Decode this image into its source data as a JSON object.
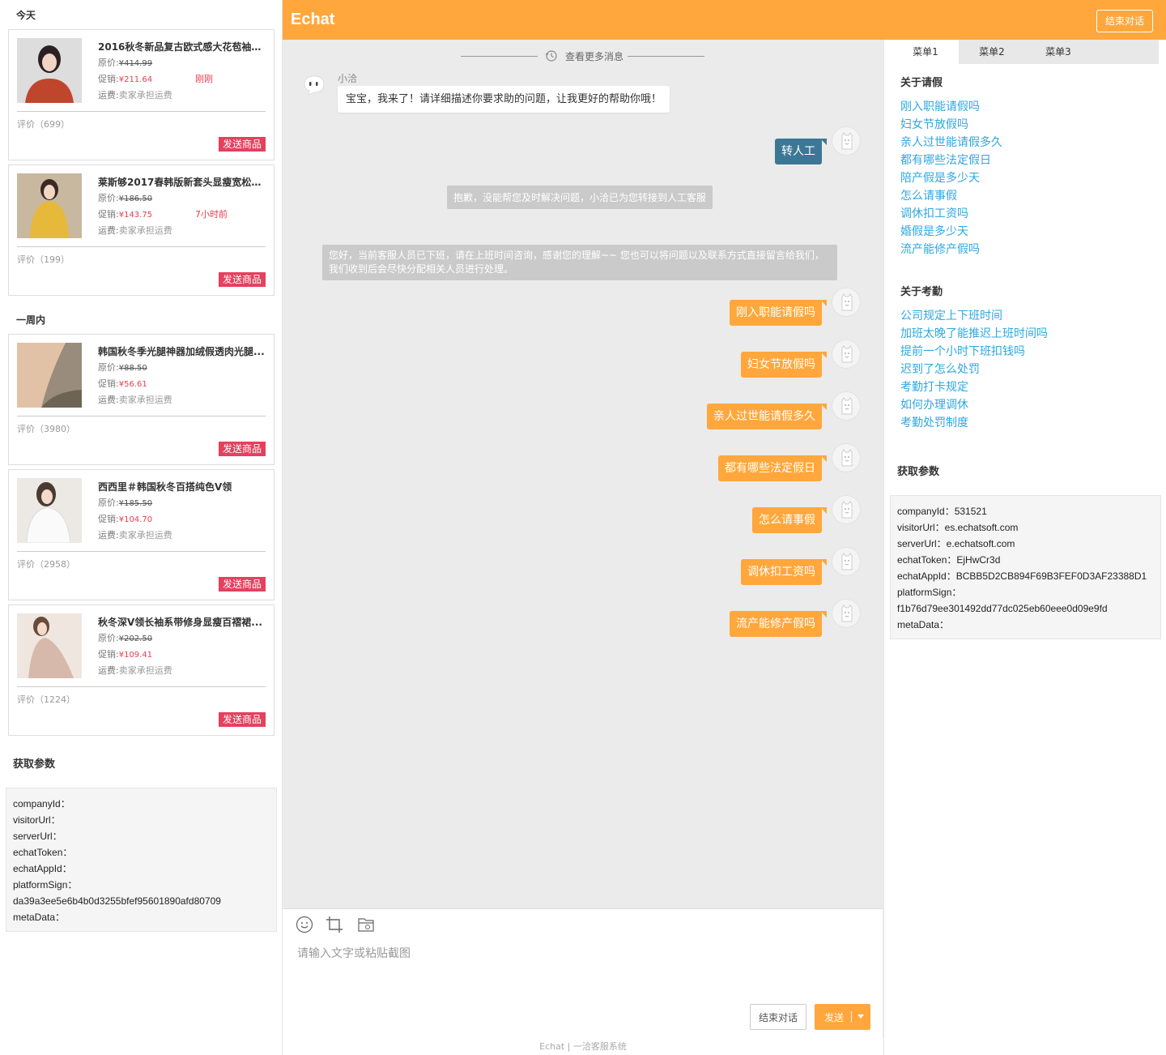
{
  "left_panel": {
    "section_today": "今天",
    "section_week": "一周内",
    "labels": {
      "original_price": "原价:",
      "promo_price": "促销:",
      "shipping": "运费:",
      "shipping_text": "卖家承担运费",
      "send_button": "发送商品"
    },
    "products": [
      {
        "name": "2016秋冬新品复古欧式感大花苞袖宽...",
        "original": "¥414.99",
        "promo": "¥211.64",
        "time": "刚刚",
        "review": "评价（699）"
      },
      {
        "name": "莱斯够2017春韩版新套头显瘦宽松V领...",
        "original": "¥186.50",
        "promo": "¥143.75",
        "time": "7小时前",
        "review": "评价（199）"
      },
      {
        "name": "韩国秋冬季光腿神器加绒假透肉光腿...",
        "original": "¥88.50",
        "promo": "¥56.61",
        "time": "",
        "review": "评价（3980）"
      },
      {
        "name": "西西里＃韩国秋冬百搭纯色V领",
        "original": "¥185.50",
        "promo": "¥104.70",
        "time": "",
        "review": "评价（2958）"
      },
      {
        "name": "秋冬深V领长袖系带修身显瘦百褶裙...",
        "original": "¥202.50",
        "promo": "¥109.41",
        "time": "",
        "review": "评价（1224）"
      }
    ],
    "params": {
      "title": "获取参数",
      "lines": [
        "companyId：",
        "visitorUrl：",
        "serverUrl：",
        "echatToken：",
        "echatAppId：",
        "platformSign：",
        "da39a3ee5e6b4b0d3255bfef95601890afd80709",
        "metaData："
      ]
    }
  },
  "header": {
    "logo": "Echat",
    "end_button": "结束对话"
  },
  "chat": {
    "more_messages": "查看更多消息",
    "agent_name": "小洽",
    "agent_greeting": "宝宝，我来了！请详细描述你要求助的问题，让我更好的帮助你哦！",
    "transfer_msg": "转人工",
    "system_sorry": "抱歉，没能帮您及时解决问题，小洽已为您转接到人工客服",
    "system_offline": "您好，当前客服人员已下班，请在上班时间咨询，感谢您的理解~~ 您也可以将问题以及联系方式直接留言给我们，我们收到后会尽快分配相关人员进行处理。",
    "user_messages": [
      "刚入职能请假吗",
      "妇女节放假吗",
      "亲人过世能请假多久",
      "都有哪些法定假日",
      "怎么请事假",
      "调休扣工资吗",
      "流产能修产假吗"
    ]
  },
  "input": {
    "placeholder": "请输入文字或粘贴截图",
    "end_button": "结束对话",
    "send_button": "发送",
    "tools": [
      "smiley-icon",
      "crop-icon",
      "folder-icon"
    ]
  },
  "footer": {
    "text": "Echat | 一洽客服系统"
  },
  "right_panel": {
    "tabs": [
      "菜单1",
      "菜单2",
      "菜单3"
    ],
    "active_tab": 0,
    "groups": [
      {
        "title": "关于请假",
        "items": [
          "刚入职能请假吗",
          "妇女节放假吗",
          "亲人过世能请假多久",
          "都有哪些法定假日",
          "陪产假是多少天",
          "怎么请事假",
          "调休扣工资吗",
          "婚假是多少天",
          "流产能修产假吗"
        ]
      },
      {
        "title": "关于考勤",
        "items": [
          "公司规定上下班时间",
          "加班太晚了能推迟上班时间吗",
          "提前一个小时下班扣钱吗",
          "迟到了怎么处罚",
          "考勤打卡规定",
          "如何办理调休",
          "考勤处罚制度"
        ]
      }
    ],
    "params": {
      "title": "获取参数",
      "lines": [
        "companyId：531521",
        "visitorUrl：es.echatsoft.com",
        "serverUrl：e.echatsoft.com",
        "echatToken：EjHwCr3d",
        "echatAppId：BCBB5D2CB894F69B3FEF0D3AF23388D1",
        "platformSign：",
        "f1b76d79ee301492dd77dc025eb60eee0d09e9fd",
        "metaData："
      ]
    }
  },
  "colors": {
    "brand_orange": "#ffa73c",
    "transfer_blue": "#3c7896",
    "promo_red": "#e5404f",
    "send_pink": "#e5405e",
    "link_blue": "#2ea7e0"
  }
}
